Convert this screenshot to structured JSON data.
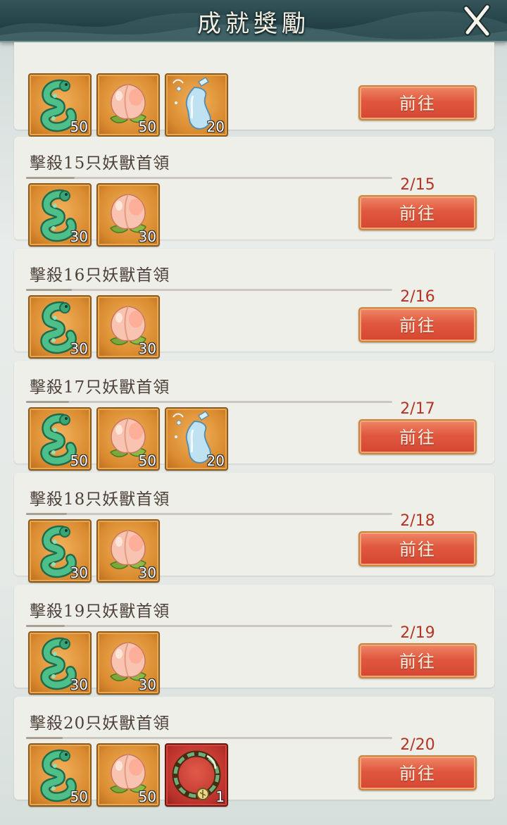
{
  "header": {
    "title": "成就獎勵"
  },
  "colors": {
    "accent": "#d54631",
    "progress_text": "#b43424",
    "header_bg": "#244146",
    "card_bg": "#efefea"
  },
  "button_label": "前往",
  "partial_card": {
    "items": [
      {
        "icon": "jade-dragon-icon",
        "qty": "50"
      },
      {
        "icon": "peach-icon",
        "qty": "50"
      },
      {
        "icon": "water-gourd-icon",
        "qty": "20"
      }
    ]
  },
  "tasks": [
    {
      "name": "擊殺15只妖獸首領",
      "progress": "2/15",
      "fraction": 0.133,
      "items": [
        {
          "icon": "jade-dragon-icon",
          "qty": "30"
        },
        {
          "icon": "peach-icon",
          "qty": "30"
        }
      ]
    },
    {
      "name": "擊殺16只妖獸首領",
      "progress": "2/16",
      "fraction": 0.125,
      "items": [
        {
          "icon": "jade-dragon-icon",
          "qty": "30"
        },
        {
          "icon": "peach-icon",
          "qty": "30"
        }
      ]
    },
    {
      "name": "擊殺17只妖獸首領",
      "progress": "2/17",
      "fraction": 0.118,
      "items": [
        {
          "icon": "jade-dragon-icon",
          "qty": "50"
        },
        {
          "icon": "peach-icon",
          "qty": "50"
        },
        {
          "icon": "water-gourd-icon",
          "qty": "20"
        }
      ]
    },
    {
      "name": "擊殺18只妖獸首領",
      "progress": "2/18",
      "fraction": 0.111,
      "items": [
        {
          "icon": "jade-dragon-icon",
          "qty": "30"
        },
        {
          "icon": "peach-icon",
          "qty": "30"
        }
      ]
    },
    {
      "name": "擊殺19只妖獸首領",
      "progress": "2/19",
      "fraction": 0.105,
      "items": [
        {
          "icon": "jade-dragon-icon",
          "qty": "30"
        },
        {
          "icon": "peach-icon",
          "qty": "30"
        }
      ]
    },
    {
      "name": "擊殺20只妖獸首領",
      "progress": "2/20",
      "fraction": 0.1,
      "items": [
        {
          "icon": "jade-dragon-icon",
          "qty": "50"
        },
        {
          "icon": "peach-icon",
          "qty": "50"
        },
        {
          "icon": "wreath-ring-icon",
          "qty": "1"
        }
      ]
    }
  ]
}
